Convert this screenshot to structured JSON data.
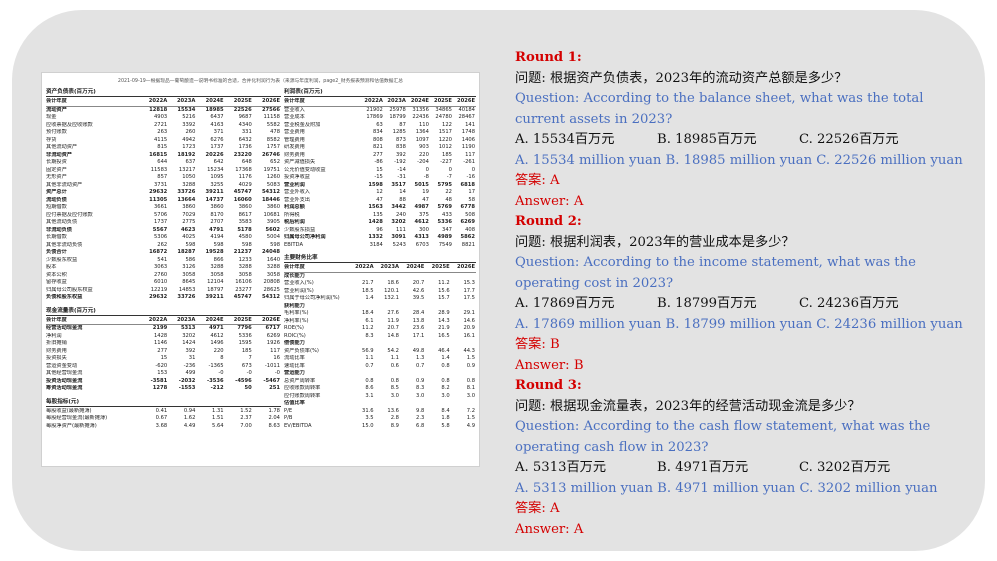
{
  "doc": {
    "title": "2021-09-19—根据现品—葡萄酿造—说明书标准的合适，合并化利润行为表（来源与年度利润，page2_财务报表预测和估值数据汇总",
    "balance": {
      "title": "资产负债表(百万元)",
      "header": [
        "会计年度",
        "2022A",
        "2023A",
        "2024E",
        "2025E",
        "2026E"
      ],
      "rows": [
        [
          "流动资产",
          "12818",
          "15534",
          "18985",
          "22526",
          "27566"
        ],
        [
          "现金",
          "4903",
          "5216",
          "6437",
          "9687",
          "11158"
        ],
        [
          "应收票据及应收账款",
          "2721",
          "3392",
          "4163",
          "4340",
          "5582"
        ],
        [
          "预付账款",
          "263",
          "260",
          "371",
          "331",
          "478"
        ],
        [
          "存货",
          "4115",
          "4942",
          "6276",
          "6432",
          "8582"
        ],
        [
          "其他流动资产",
          "815",
          "1723",
          "1737",
          "1736",
          "1757"
        ],
        [
          "非流动资产",
          "16815",
          "18192",
          "20226",
          "23220",
          "26746"
        ],
        [
          "长期投资",
          "644",
          "637",
          "642",
          "648",
          "652"
        ],
        [
          "固定资产",
          "11583",
          "13217",
          "15234",
          "17368",
          "19751"
        ],
        [
          "无形资产",
          "857",
          "1050",
          "1095",
          "1176",
          "1260"
        ],
        [
          "其他非流动资产",
          "3731",
          "3288",
          "3255",
          "4029",
          "5083"
        ],
        [
          "资产总计",
          "29632",
          "33726",
          "39211",
          "45747",
          "54312"
        ],
        [
          "流动负债",
          "11305",
          "13664",
          "14737",
          "16060",
          "18446"
        ],
        [
          "短期借款",
          "3661",
          "3860",
          "3860",
          "3860",
          "3860"
        ],
        [
          "应付票据及应付账款",
          "5706",
          "7029",
          "8170",
          "8617",
          "10681"
        ],
        [
          "其他流动负债",
          "1737",
          "2775",
          "2707",
          "3583",
          "3905"
        ],
        [
          "非流动负债",
          "5567",
          "4623",
          "4791",
          "5178",
          "5602"
        ],
        [
          "长期借款",
          "5306",
          "4025",
          "4194",
          "4580",
          "5004"
        ],
        [
          "其他非流动负债",
          "262",
          "598",
          "598",
          "598",
          "598"
        ],
        [
          "负债合计",
          "16872",
          "18287",
          "19528",
          "21237",
          "24048"
        ],
        [
          "少数股东权益",
          "541",
          "586",
          "866",
          "1233",
          "1640"
        ],
        [
          "股本",
          "3063",
          "3126",
          "3288",
          "3288",
          "3288"
        ],
        [
          "资本公积",
          "2760",
          "3058",
          "3058",
          "3058",
          "3058"
        ],
        [
          "留存收益",
          "6010",
          "8645",
          "12104",
          "16106",
          "20808"
        ],
        [
          "归属母公司股东权益",
          "12219",
          "14853",
          "18797",
          "23277",
          "28625"
        ],
        [
          "负债和股东权益",
          "29632",
          "33726",
          "39211",
          "45747",
          "54312"
        ]
      ]
    },
    "cashflow": {
      "title": "现金流量表(百万元)",
      "header": [
        "会计年度",
        "2022A",
        "2023A",
        "2024E",
        "2025E",
        "2026E"
      ],
      "rows": [
        [
          "经营活动现金流",
          "2199",
          "5313",
          "4971",
          "7796",
          "6717"
        ],
        [
          "净利润",
          "1428",
          "3202",
          "4612",
          "5336",
          "6269"
        ],
        [
          "折旧摊销",
          "1146",
          "1424",
          "1496",
          "1595",
          "1926"
        ],
        [
          "财务费用",
          "277",
          "392",
          "220",
          "185",
          "117"
        ],
        [
          "投资损失",
          "15",
          "31",
          "8",
          "7",
          "16"
        ],
        [
          "营运资金变动",
          "-620",
          "-236",
          "-1365",
          "673",
          "-1011"
        ],
        [
          "其他经营现金流",
          "153",
          "499",
          "-0",
          "-0",
          "-0"
        ],
        [
          "投资活动现金流",
          "-3581",
          "-2032",
          "-3536",
          "-4596",
          "-5467"
        ],
        [
          "筹资活动现金流",
          "1278",
          "-1553",
          "-212",
          "50",
          "251"
        ]
      ]
    },
    "pershare": {
      "title": "每股指标(元)",
      "rows": [
        [
          "每股收益(最新摊薄)",
          "0.41",
          "0.94",
          "1.31",
          "1.52",
          "1.78"
        ],
        [
          "每股经营现金流(最新摊薄)",
          "0.67",
          "1.62",
          "1.51",
          "2.37",
          "2.04"
        ],
        [
          "每股净资产(最新摊薄)",
          "3.68",
          "4.49",
          "5.64",
          "7.00",
          "8.63"
        ]
      ]
    },
    "income": {
      "title": "利润表(百万元)",
      "header": [
        "会计年度",
        "2022A",
        "2023A",
        "2024E",
        "2025E",
        "2026E"
      ],
      "rows": [
        [
          "营业收入",
          "21902",
          "25978",
          "31356",
          "34865",
          "40184"
        ],
        [
          "营业成本",
          "17869",
          "18799",
          "22436",
          "24780",
          "28467"
        ],
        [
          "营业税金及附加",
          "63",
          "87",
          "110",
          "122",
          "141"
        ],
        [
          "营业费用",
          "834",
          "1285",
          "1364",
          "1517",
          "1748"
        ],
        [
          "管理费用",
          "808",
          "873",
          "1097",
          "1220",
          "1406"
        ],
        [
          "研发费用",
          "821",
          "838",
          "903",
          "1012",
          "1190"
        ],
        [
          "财务费用",
          "277",
          "392",
          "220",
          "185",
          "117"
        ],
        [
          "资产减值损失",
          "-86",
          "-192",
          "-204",
          "-227",
          "-261"
        ],
        [
          "公允价值变动收益",
          "15",
          "-14",
          "0",
          "0",
          "0"
        ],
        [
          "投资净收益",
          "-15",
          "-31",
          "-8",
          "-7",
          "-16"
        ],
        [
          "营业利润",
          "1598",
          "3517",
          "5015",
          "5795",
          "6818"
        ],
        [
          "营业外收入",
          "12",
          "14",
          "19",
          "22",
          "17"
        ],
        [
          "营业外支出",
          "47",
          "88",
          "47",
          "48",
          "58"
        ],
        [
          "利润总额",
          "1563",
          "3442",
          "4987",
          "5769",
          "6778"
        ],
        [
          "所得税",
          "135",
          "240",
          "375",
          "433",
          "508"
        ],
        [
          "税后利润",
          "1428",
          "3202",
          "4612",
          "5336",
          "6269"
        ],
        [
          "少数股东损益",
          "96",
          "111",
          "300",
          "347",
          "408"
        ],
        [
          "归属母公司净利润",
          "1332",
          "3091",
          "4313",
          "4989",
          "5862"
        ],
        [
          "EBITDA",
          "3184",
          "5243",
          "6703",
          "7549",
          "8821"
        ]
      ]
    },
    "ratios": {
      "title": "主要财务比率",
      "header": [
        "会计年度",
        "2022A",
        "2023A",
        "2024E",
        "2025E",
        "2026E"
      ],
      "rows": [
        [
          "成长能力",
          "",
          "",
          "",
          "",
          ""
        ],
        [
          "营业收入(%)",
          "21.7",
          "18.6",
          "20.7",
          "11.2",
          "15.3"
        ],
        [
          "营业利润(%)",
          "18.5",
          "120.1",
          "42.6",
          "15.6",
          "17.7"
        ],
        [
          "归属于母公司净利润(%)",
          "1.4",
          "132.1",
          "39.5",
          "15.7",
          "17.5"
        ],
        [
          "获利能力",
          "",
          "",
          "",
          "",
          ""
        ],
        [
          "毛利率(%)",
          "18.4",
          "27.6",
          "28.4",
          "28.9",
          "29.1"
        ],
        [
          "净利率(%)",
          "6.1",
          "11.9",
          "13.8",
          "14.3",
          "14.6"
        ],
        [
          "ROE(%)",
          "11.2",
          "20.7",
          "23.6",
          "21.9",
          "20.9"
        ],
        [
          "ROIC(%)",
          "8.3",
          "14.8",
          "17.1",
          "16.5",
          "16.1"
        ],
        [
          "偿债能力",
          "",
          "",
          "",
          "",
          ""
        ],
        [
          "资产负债率(%)",
          "56.9",
          "54.2",
          "49.8",
          "46.4",
          "44.3"
        ],
        [
          "流动比率",
          "1.1",
          "1.1",
          "1.3",
          "1.4",
          "1.5"
        ],
        [
          "速动比率",
          "0.7",
          "0.6",
          "0.7",
          "0.8",
          "0.9"
        ],
        [
          "营运能力",
          "",
          "",
          "",
          "",
          ""
        ],
        [
          "总资产周转率",
          "0.8",
          "0.8",
          "0.9",
          "0.8",
          "0.8"
        ],
        [
          "应收账款周转率",
          "8.6",
          "8.5",
          "8.3",
          "8.2",
          "8.1"
        ],
        [
          "应付账款周转率",
          "3.1",
          "3.0",
          "3.0",
          "3.0",
          "3.0"
        ],
        [
          "估值比率",
          "",
          "",
          "",
          "",
          ""
        ],
        [
          "P/E",
          "31.6",
          "13.6",
          "9.8",
          "8.4",
          "7.2"
        ],
        [
          "P/B",
          "3.5",
          "2.8",
          "2.3",
          "1.8",
          "1.5"
        ],
        [
          "EV/EBITDA",
          "15.0",
          "8.9",
          "6.8",
          "5.8",
          "4.9"
        ]
      ]
    }
  },
  "qa": [
    {
      "round": "Round 1:",
      "q_zh": "问题: 根据资产负债表，2023年的流动资产总额是多少？",
      "q_en": "Question: According to the balance sheet, what was the total current assets in 2023?",
      "opts_zh": [
        "A. 15534百万元",
        "B. 18985百万元",
        "C. 22526百万元"
      ],
      "opts_en": "A. 15534 million yuan B. 18985 million yuan C. 22526 million yuan",
      "ans_zh": "答案: A",
      "ans_en": "Answer: A"
    },
    {
      "round": "Round 2:",
      "q_zh": "问题: 根据利润表，2023年的营业成本是多少？",
      "q_en": "Question: According to the income statement, what was the operating cost in 2023?",
      "opts_zh": [
        "A. 17869百万元",
        "B. 18799百万元",
        "C. 24236百万元"
      ],
      "opts_en": "A. 17869 million yuan B. 18799 million yuan C. 24236 million yuan",
      "ans_zh": "答案: B",
      "ans_en": "Answer: B"
    },
    {
      "round": "Round 3:",
      "q_zh": "问题: 根据现金流量表，2023年的经营活动现金流是多少？",
      "q_en": "Question: According to the cash flow statement, what was the operating cash flow in 2023?",
      "opts_zh": [
        "A. 5313百万元",
        "B. 4971百万元",
        "C. 3202百万元"
      ],
      "opts_en": "A. 5313 million yuan B. 4971 million yuan C. 3202 million yuan",
      "ans_zh": "答案: A",
      "ans_en": "Answer: A"
    }
  ]
}
